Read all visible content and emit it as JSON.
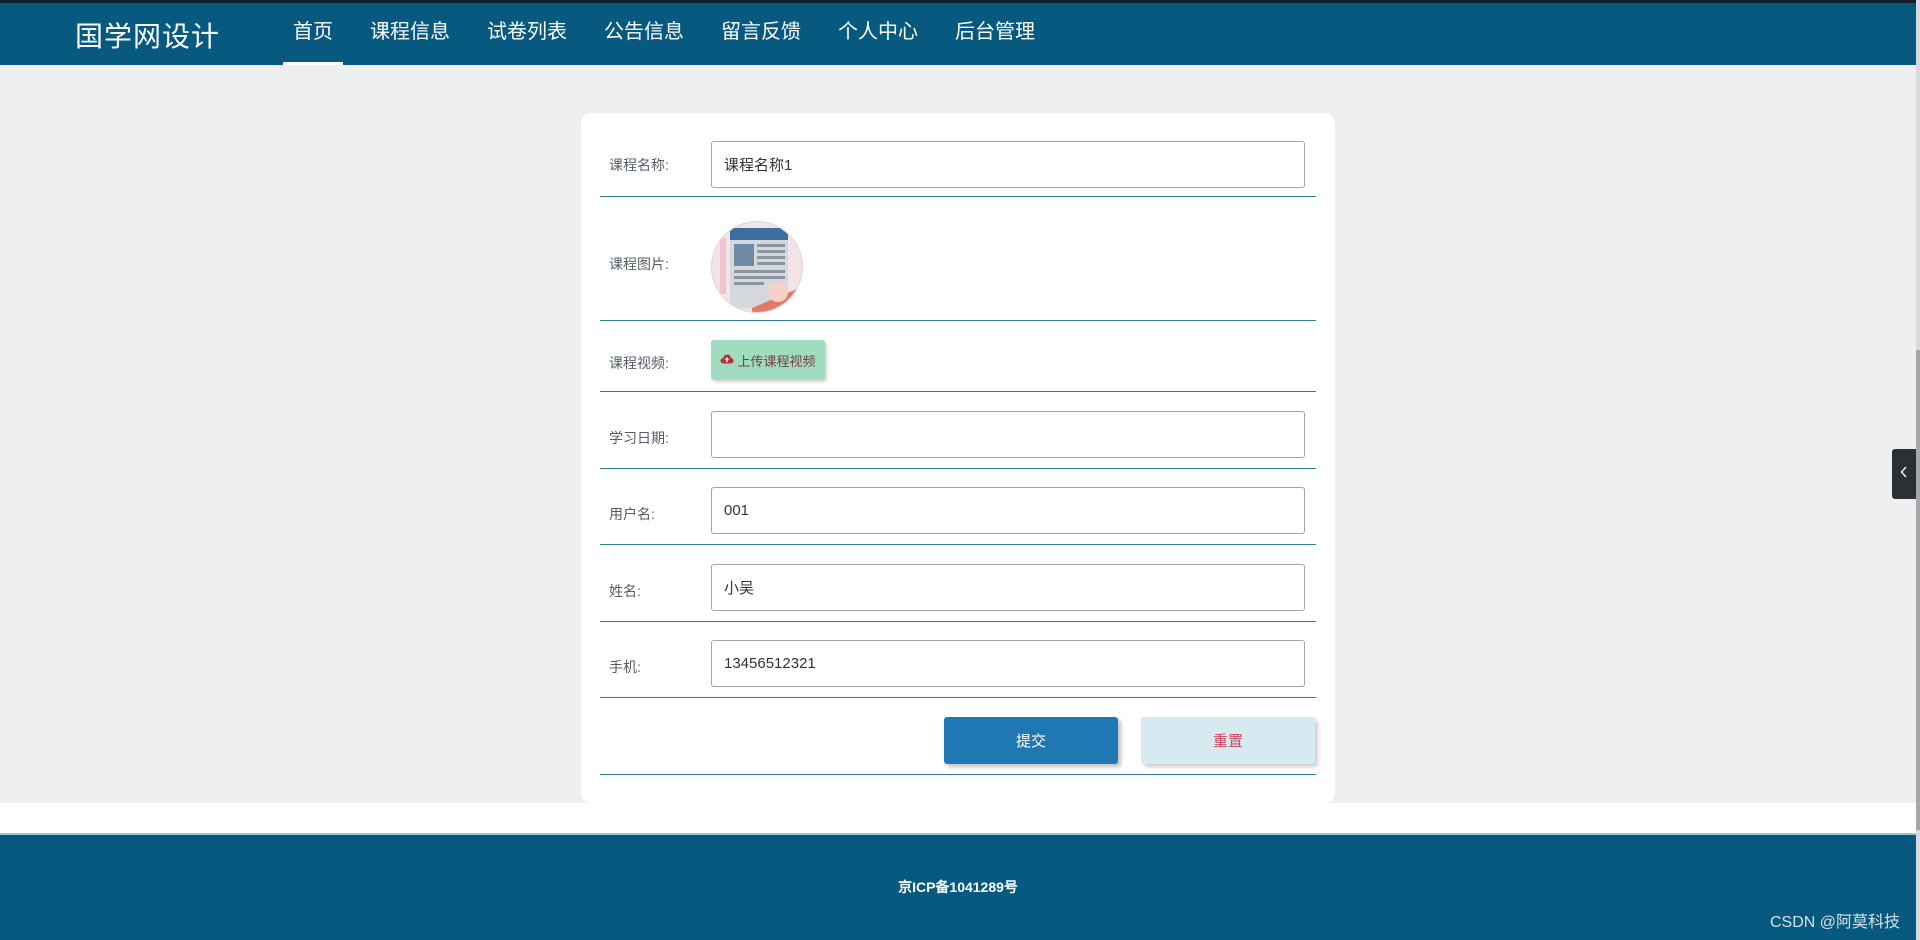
{
  "brand": "国学网设计",
  "nav": {
    "items": [
      "首页",
      "课程信息",
      "试卷列表",
      "公告信息",
      "留言反馈",
      "个人中心",
      "后台管理"
    ],
    "active": "首页"
  },
  "form": {
    "course_name": {
      "label": "课程名称:",
      "value": "课程名称1"
    },
    "course_image": {
      "label": "课程图片:"
    },
    "course_video": {
      "label": "课程视频:",
      "button": "上传课程视频"
    },
    "study_date": {
      "label": "学习日期:",
      "value": ""
    },
    "username": {
      "label": "用户名:",
      "value": "001"
    },
    "name": {
      "label": "姓名:",
      "value": "小吴"
    },
    "phone": {
      "label": "手机:",
      "value": "13456512321"
    },
    "submit_label": "提交",
    "reset_label": "重置"
  },
  "footer": {
    "icp": "京ICP备1041289号"
  },
  "watermark": "CSDN @阿莫科技",
  "colors": {
    "header_bg": "#07597f",
    "page_bg": "#eeeff1",
    "row_border": "#2f7b93",
    "submit_bg": "#1f78b4",
    "reset_bg": "#d5ebf1",
    "reset_text": "#d0475f",
    "upload_bg": "#9fdcc0"
  },
  "icons": {
    "upload": "cloud-upload-icon",
    "side_tab": "chevron-left-icon"
  }
}
